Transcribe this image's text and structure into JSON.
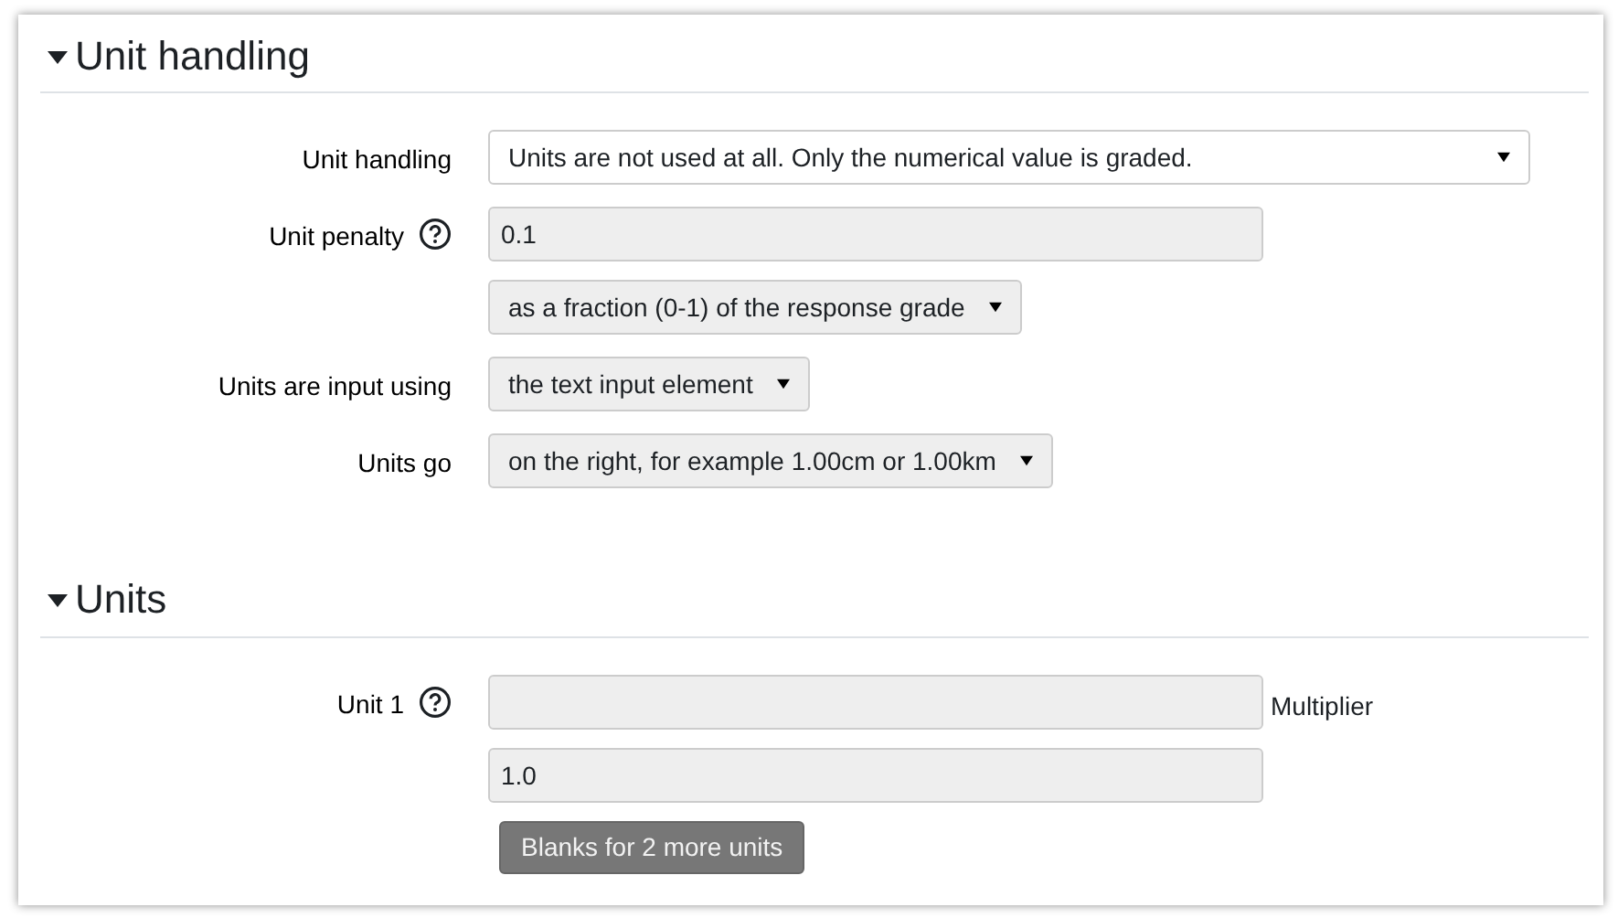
{
  "sections": [
    {
      "title": "Unit handling",
      "expanded": true,
      "fields": [
        {
          "label": "Unit handling",
          "help": false,
          "lines": [
            [
              {
                "kind": "select",
                "value": "Units are not used at all. Only the numerical value is graded.",
                "disabled": false
              }
            ]
          ]
        },
        {
          "label": "Unit penalty",
          "help": true,
          "lines": [
            [
              {
                "kind": "input",
                "value": "0.1",
                "disabled": true
              }
            ],
            [
              {
                "kind": "select",
                "value": "as a fraction (0-1) of the response grade",
                "disabled": true
              }
            ]
          ]
        },
        {
          "label": "Units are input using",
          "help": false,
          "lines": [
            [
              {
                "kind": "select",
                "value": "the text input element",
                "disabled": true
              }
            ]
          ]
        },
        {
          "label": "Units go",
          "help": false,
          "lines": [
            [
              {
                "kind": "select",
                "value": "on the right, for example 1.00cm or 1.00km",
                "disabled": true
              }
            ]
          ]
        }
      ]
    },
    {
      "title": "Units",
      "expanded": true,
      "fields": [
        {
          "label": "Unit 1",
          "help": true,
          "lines": [
            [
              {
                "kind": "input",
                "disabled": true
              },
              {
                "kind": "caption",
                "value": "Multiplier"
              }
            ],
            [
              {
                "kind": "input",
                "value": "1.0",
                "disabled": true
              }
            ],
            [
              {
                "kind": "button",
                "value": "Blanks for 2 more units",
                "disabled": true
              }
            ]
          ]
        }
      ]
    }
  ]
}
